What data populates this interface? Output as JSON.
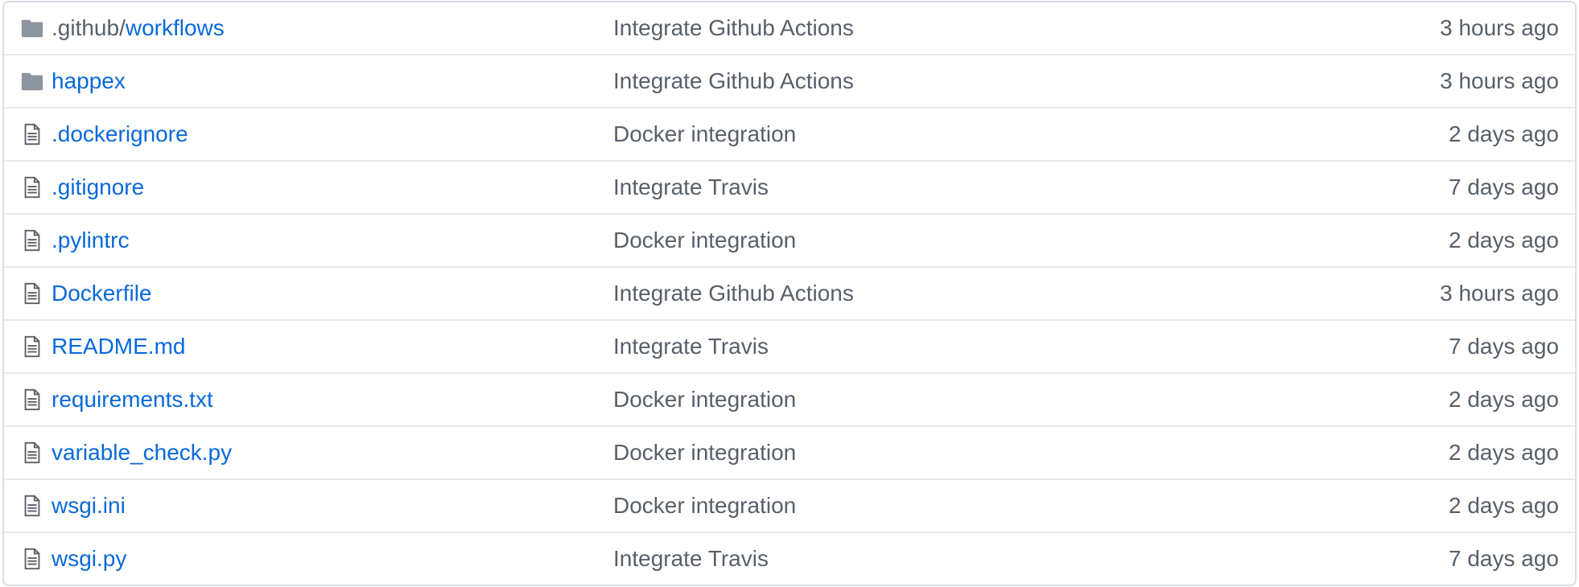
{
  "colors": {
    "link": "#0969da",
    "muted_text": "#57606a",
    "folder_icon": "#54aeff",
    "file_icon": "#57606a",
    "border": "#d8dee4"
  },
  "files": [
    {
      "type": "directory",
      "icon": "folder-icon",
      "prefix": ".github/",
      "name": "workflows",
      "message": "Integrate Github Actions",
      "age": "3 hours ago"
    },
    {
      "type": "directory",
      "icon": "folder-icon",
      "prefix": "",
      "name": "happex",
      "message": "Integrate Github Actions",
      "age": "3 hours ago"
    },
    {
      "type": "file",
      "icon": "file-icon",
      "prefix": "",
      "name": ".dockerignore",
      "message": "Docker integration",
      "age": "2 days ago"
    },
    {
      "type": "file",
      "icon": "file-icon",
      "prefix": "",
      "name": ".gitignore",
      "message": "Integrate Travis",
      "age": "7 days ago"
    },
    {
      "type": "file",
      "icon": "file-icon",
      "prefix": "",
      "name": ".pylintrc",
      "message": "Docker integration",
      "age": "2 days ago"
    },
    {
      "type": "file",
      "icon": "file-icon",
      "prefix": "",
      "name": "Dockerfile",
      "message": "Integrate Github Actions",
      "age": "3 hours ago"
    },
    {
      "type": "file",
      "icon": "file-icon",
      "prefix": "",
      "name": "README.md",
      "message": "Integrate Travis",
      "age": "7 days ago"
    },
    {
      "type": "file",
      "icon": "file-icon",
      "prefix": "",
      "name": "requirements.txt",
      "message": "Docker integration",
      "age": "2 days ago"
    },
    {
      "type": "file",
      "icon": "file-icon",
      "prefix": "",
      "name": "variable_check.py",
      "message": "Docker integration",
      "age": "2 days ago"
    },
    {
      "type": "file",
      "icon": "file-icon",
      "prefix": "",
      "name": "wsgi.ini",
      "message": "Docker integration",
      "age": "2 days ago"
    },
    {
      "type": "file",
      "icon": "file-icon",
      "prefix": "",
      "name": "wsgi.py",
      "message": "Integrate Travis",
      "age": "7 days ago"
    }
  ]
}
